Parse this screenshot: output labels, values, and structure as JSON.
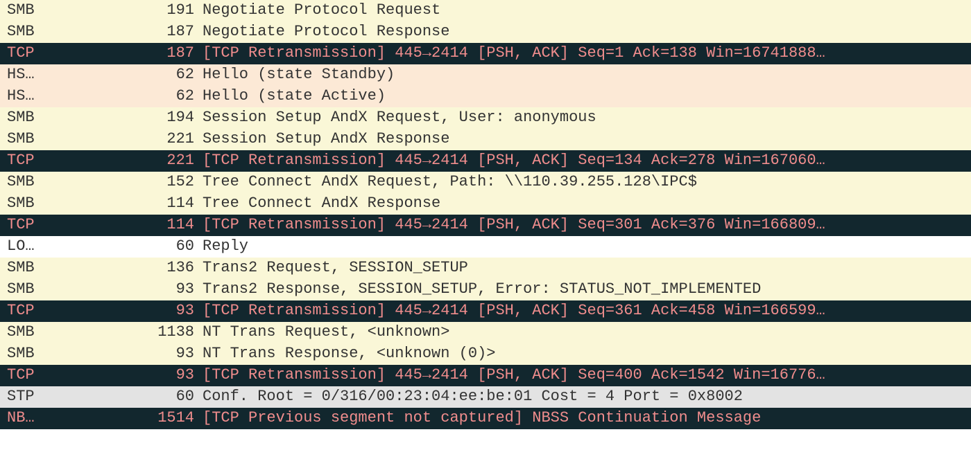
{
  "packets": [
    {
      "proto": "SMB",
      "len": "191",
      "info": "Negotiate Protocol Request",
      "bg": "bg-yellow"
    },
    {
      "proto": "SMB",
      "len": "187",
      "info": "Negotiate Protocol Response",
      "bg": "bg-yellow"
    },
    {
      "proto": "TCP",
      "len": "187",
      "info": "[TCP Retransmission] 445→2414 [PSH, ACK] Seq=1 Ack=138 Win=16741888…",
      "bg": "bg-dark"
    },
    {
      "proto": "HS…",
      "len": "62",
      "info": "Hello (state Standby)",
      "bg": "bg-peach"
    },
    {
      "proto": "HS…",
      "len": "62",
      "info": "Hello (state Active)",
      "bg": "bg-peach"
    },
    {
      "proto": "SMB",
      "len": "194",
      "info": "Session Setup AndX Request, User: anonymous",
      "bg": "bg-yellow"
    },
    {
      "proto": "SMB",
      "len": "221",
      "info": "Session Setup AndX Response",
      "bg": "bg-yellow"
    },
    {
      "proto": "TCP",
      "len": "221",
      "info": "[TCP Retransmission] 445→2414 [PSH, ACK] Seq=134 Ack=278 Win=167060…",
      "bg": "bg-dark"
    },
    {
      "proto": "SMB",
      "len": "152",
      "info": "Tree Connect AndX Request, Path: \\\\110.39.255.128\\IPC$",
      "bg": "bg-yellow"
    },
    {
      "proto": "SMB",
      "len": "114",
      "info": "Tree Connect AndX Response",
      "bg": "bg-yellow"
    },
    {
      "proto": "TCP",
      "len": "114",
      "info": "[TCP Retransmission] 445→2414 [PSH, ACK] Seq=301 Ack=376 Win=166809…",
      "bg": "bg-dark"
    },
    {
      "proto": "LO…",
      "len": "60",
      "info": "Reply",
      "bg": "bg-white"
    },
    {
      "proto": "SMB",
      "len": "136",
      "info": "Trans2 Request, SESSION_SETUP",
      "bg": "bg-yellow"
    },
    {
      "proto": "SMB",
      "len": "93",
      "info": "Trans2 Response, SESSION_SETUP, Error: STATUS_NOT_IMPLEMENTED",
      "bg": "bg-yellow"
    },
    {
      "proto": "TCP",
      "len": "93",
      "info": "[TCP Retransmission] 445→2414 [PSH, ACK] Seq=361 Ack=458 Win=166599…",
      "bg": "bg-dark"
    },
    {
      "proto": "SMB",
      "len": "1138",
      "info": "NT Trans Request, <unknown>",
      "bg": "bg-yellow"
    },
    {
      "proto": "SMB",
      "len": "93",
      "info": "NT Trans Response, <unknown (0)>",
      "bg": "bg-yellow"
    },
    {
      "proto": "TCP",
      "len": "93",
      "info": "[TCP Retransmission] 445→2414 [PSH, ACK] Seq=400 Ack=1542 Win=16776…",
      "bg": "bg-dark"
    },
    {
      "proto": "STP",
      "len": "60",
      "info": "Conf. Root = 0/316/00:23:04:ee:be:01  Cost = 4  Port = 0x8002",
      "bg": "bg-gray"
    },
    {
      "proto": "NB…",
      "len": "1514",
      "info": "[TCP Previous segment not captured] NBSS Continuation Message",
      "bg": "bg-dark"
    }
  ]
}
